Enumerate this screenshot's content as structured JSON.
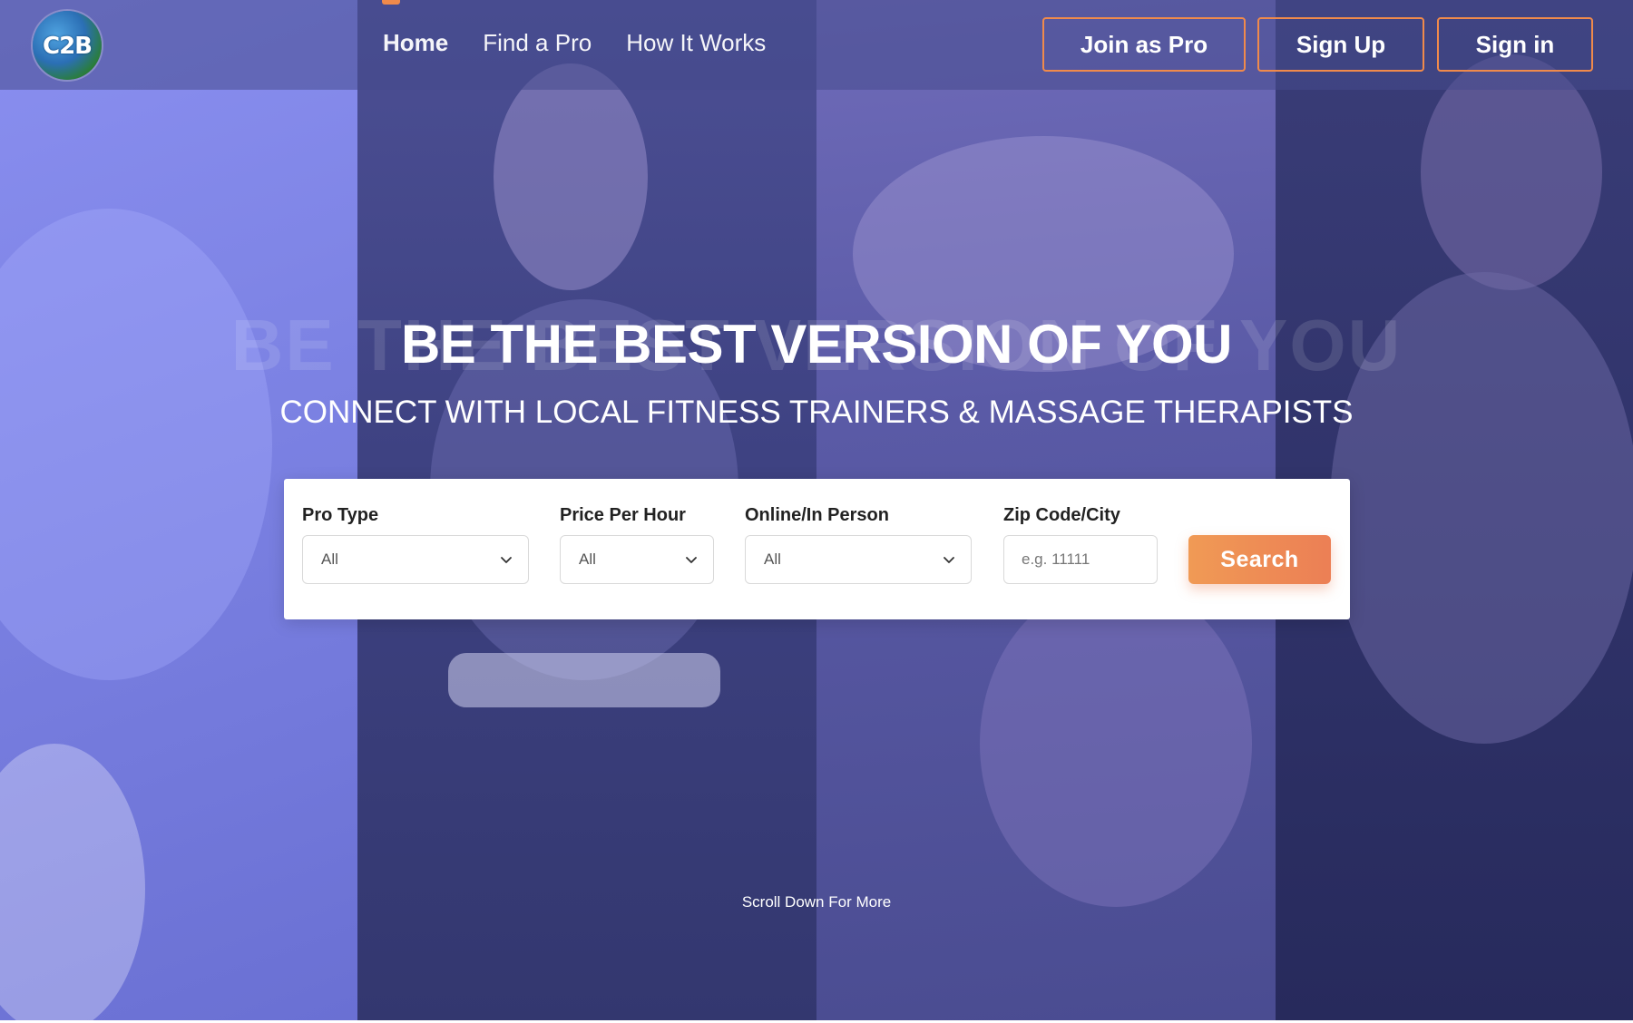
{
  "logo": {
    "text": "C2B"
  },
  "nav": {
    "items": [
      {
        "label": "Home",
        "active": true
      },
      {
        "label": "Find a Pro",
        "active": false
      },
      {
        "label": "How It Works",
        "active": false
      }
    ]
  },
  "header_buttons": {
    "join": "Join as Pro",
    "signup": "Sign Up",
    "signin": "Sign in"
  },
  "hero": {
    "title": "BE THE BEST VERSION OF YOU",
    "ghost_title": "BE THE BEST VERSION OF YOU",
    "subtitle": "CONNECT WITH LOCAL FITNESS TRAINERS & MASSAGE THERAPISTS"
  },
  "search": {
    "pro_type": {
      "label": "Pro Type",
      "value": "All"
    },
    "price": {
      "label": "Price Per Hour",
      "value": "All"
    },
    "mode": {
      "label": "Online/In Person",
      "value": "All"
    },
    "zip": {
      "label": "Zip Code/City",
      "placeholder": "e.g. 11111"
    },
    "button": "Search"
  },
  "scroll_hint": "Scroll Down For More",
  "colors": {
    "accent": "#f08a4b",
    "search_button": "#ee8a55",
    "overlay": "#464a8c"
  }
}
